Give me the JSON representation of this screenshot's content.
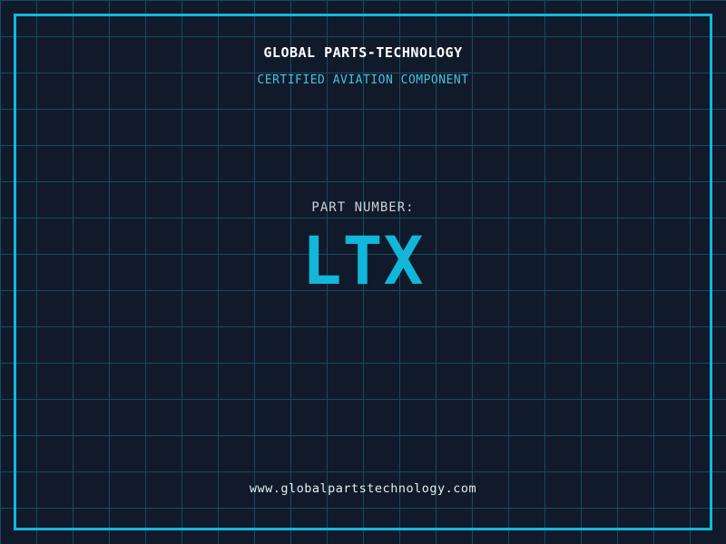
{
  "label": {
    "company": "GLOBAL PARTS-TECHNOLOGY",
    "subtitle": "CERTIFIED AVIATION COMPONENT",
    "part_label": "PART NUMBER:",
    "part_number": "LTX",
    "website": "www.globalpartstechnology.com"
  },
  "colors": {
    "bg": "#101a2b",
    "grid": "#19495e",
    "frame": "#14b8dc",
    "accent": "#12b6d9",
    "accent-light": "#45c2dd",
    "white": "#ffffff",
    "muted": "#c9d1d9",
    "url": "#e8ecef"
  }
}
